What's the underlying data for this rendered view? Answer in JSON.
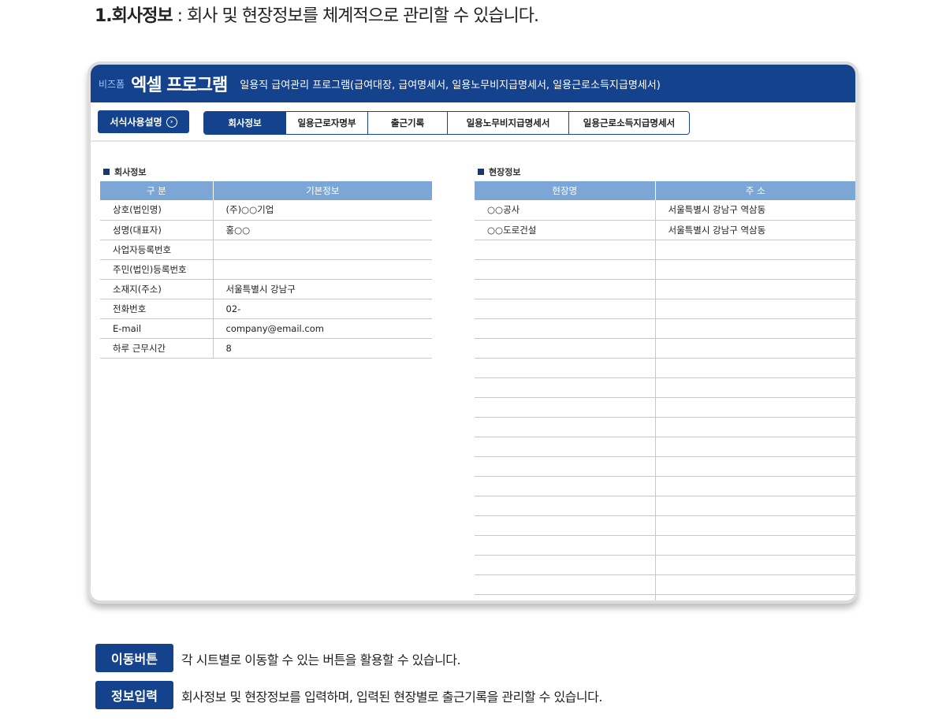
{
  "heading": {
    "bold": "1.회사정보",
    "rest": " : 회사 및 현장정보를 체계적으로 관리할 수 있습니다."
  },
  "app": {
    "brand_small": "비즈폼",
    "brand": "엑셀 프로그램",
    "subtitle": "일용직 급여관리 프로그램(급여대장, 급여명세서, 일용노무비지급명세서, 일용근로소득지급명세서)"
  },
  "toolbar": {
    "guide_label": "서식사용설명",
    "tabs": [
      "회사정보",
      "일용근로자명부",
      "출근기록",
      "일용노무비지급명세서",
      "일용근로소득지급명세서"
    ]
  },
  "company": {
    "title": "회사정보",
    "headers": [
      "구 분",
      "기본정보"
    ],
    "rows": [
      [
        "상호(법인명)",
        "(주)○○기업"
      ],
      [
        "성명(대표자)",
        "홍○○"
      ],
      [
        "사업자등록번호",
        ""
      ],
      [
        "주민(법인)등록번호",
        ""
      ],
      [
        "소재지(주소)",
        "서울특별시 강남구"
      ],
      [
        "전화번호",
        "02-"
      ],
      [
        "E-mail",
        "company@email.com"
      ],
      [
        "하루 근무시간",
        "8"
      ]
    ]
  },
  "sites": {
    "title": "현장정보",
    "headers": [
      "현장명",
      "주 소"
    ],
    "rows": [
      [
        "○○공사",
        "서울특별시 강남구 역삼동"
      ],
      [
        "○○도로건설",
        "서울특별시 강남구 역삼동"
      ]
    ]
  },
  "notes": [
    {
      "badge": "이동버튼",
      "text": "각 시트별로 이동할 수 있는 버튼을 활용할 수 있습니다."
    },
    {
      "badge": "정보입력",
      "text": "회사정보 및 현장정보를 입력하며, 입력된 현장별로 출근기록을 관리할 수 있습니다."
    }
  ]
}
